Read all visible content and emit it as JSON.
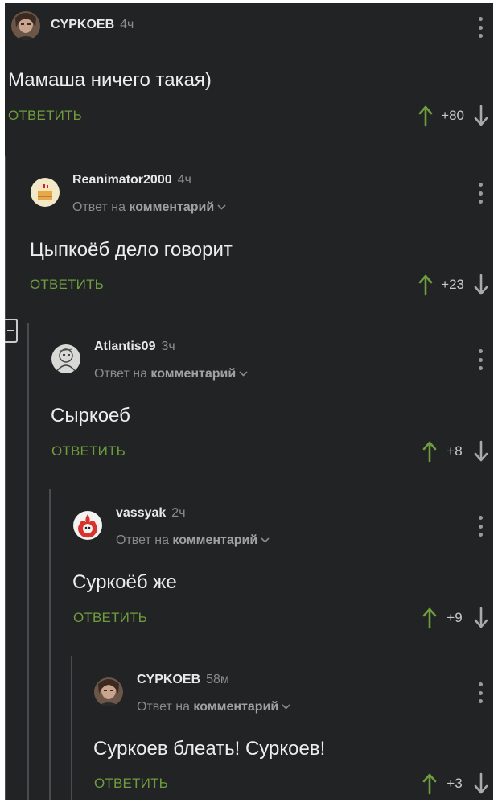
{
  "ui": {
    "reply_label": "ОТВЕТИТЬ",
    "reply_prefix": "Ответ на",
    "reply_target": "комментарий"
  },
  "comments": [
    {
      "username": "CYPKOEB",
      "time": "4ч",
      "text": "Мамаша ничего такая)",
      "score": "+80",
      "avatar": "portrait-avatar",
      "level": 0
    },
    {
      "username": "Reanimator2000",
      "time": "4ч",
      "text": "Цыпкоёб дело говорит",
      "score": "+23",
      "avatar": "cake-avatar",
      "level": 1
    },
    {
      "username": "Atlantis09",
      "time": "3ч",
      "text": "Сыркоеб",
      "score": "+8",
      "avatar": "sketch-avatar",
      "level": 2
    },
    {
      "username": "vassyak",
      "time": "2ч",
      "text": "Суркоёб же",
      "score": "+9",
      "avatar": "flame-avatar",
      "level": 3
    },
    {
      "username": "CYPKOEB",
      "time": "58м",
      "text": "Суркоев блеать! Суркоев!",
      "score": "+3",
      "avatar": "portrait-avatar",
      "level": 4
    }
  ],
  "colors": {
    "background": "#222325",
    "accent_green": "#6f9d3e",
    "text": "#ededed",
    "muted": "#8a8b8d"
  }
}
